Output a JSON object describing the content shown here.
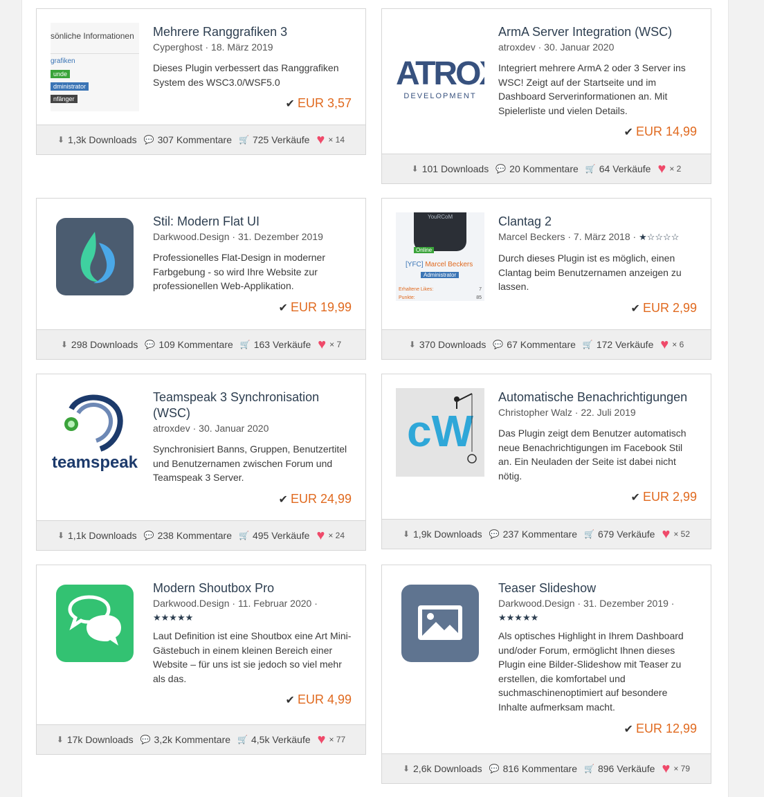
{
  "currency_check": "✔",
  "icons": {
    "download": "download-icon",
    "comments": "comments-icon",
    "cart": "cart-icon",
    "heart": "heart-icon"
  },
  "accent_color": "#e0691e",
  "like_color": "#ef4a6a",
  "cards": [
    {
      "title": "Mehrere Ranggrafiken 3",
      "author": "Cyperghost",
      "date": "18. März 2019",
      "rating": "",
      "desc": "Dieses Plugin verbessert das Ranggrafiken System des WSC3.0/WSF5.0",
      "price": "EUR 3,57",
      "downloads": "1,3k Downloads",
      "comments": "307 Kommentare",
      "sales": "725 Verkäufe",
      "likes": "× 14",
      "thumb_lines": [
        "sönliche Informationen",
        "grafiken",
        "unde",
        "dministrator",
        "nfänger"
      ]
    },
    {
      "title": "ArmA Server Integration (WSC)",
      "author": "atroxdev",
      "date": "30. Januar 2020",
      "rating": "",
      "desc": "Integriert mehrere ArmA 2 oder 3 Server ins WSC! Zeigt auf der Startseite und im Dashboard Serverinformationen an. Mit Spielerliste und vielen Details.",
      "price": "EUR 14,99",
      "downloads": "101 Downloads",
      "comments": "20 Kommentare",
      "sales": "64 Verkäufe",
      "likes": "× 2",
      "logo_text": "ATROX",
      "logo_sub": "DEVELOPMENT"
    },
    {
      "title": "Stil: Modern Flat UI",
      "author": "Darkwood.Design",
      "date": "31. Dezember 2019",
      "rating": "",
      "desc": "Professionelles Flat-Design in moderner Farbgebung - so wird Ihre Website zur professionellen Web-Applikation.",
      "price": "EUR 19,99",
      "downloads": "298 Downloads",
      "comments": "109 Kommentare",
      "sales": "163 Verkäufe",
      "likes": "× 7"
    },
    {
      "title": "Clantag 2",
      "author": "Marcel Beckers",
      "date": "7. März 2018",
      "rating": "★☆☆☆☆",
      "desc": "Durch dieses Plugin ist es möglich, einen Clantag beim Benutzernamen anzeigen zu lassen.",
      "price": "EUR 2,99",
      "downloads": "370 Downloads",
      "comments": "67 Kommentare",
      "sales": "172 Verkäufe",
      "likes": "× 6",
      "thumb_lines": [
        "YouRCoM",
        "Online",
        "[YFC]",
        "Marcel Beckers",
        "Administrator",
        "Erhaltene Likes:",
        "7",
        "Punkte:",
        "85"
      ]
    },
    {
      "title": "Teamspeak 3 Synchronisation (WSC)",
      "author": "atroxdev",
      "date": "30. Januar 2020",
      "rating": "",
      "desc": "Synchronisiert Banns, Gruppen, Benutzertitel und Benutzernamen zwischen Forum und Teamspeak 3 Server.",
      "price": "EUR 24,99",
      "downloads": "1,1k Downloads",
      "comments": "238 Kommentare",
      "sales": "495 Verkäufe",
      "likes": "× 24",
      "logo_text": "teamspeak"
    },
    {
      "title": "Automatische Benachrichtigungen",
      "author": "Christopher Walz",
      "date": "22. Juli 2019",
      "rating": "",
      "desc": "Das Plugin zeigt dem Benutzer automatisch neue Benachrichtigungen im Facebook Stil an. Ein Neuladen der Seite ist dabei nicht nötig.",
      "price": "EUR 2,99",
      "downloads": "1,9k Downloads",
      "comments": "237 Kommentare",
      "sales": "679 Verkäufe",
      "likes": "× 52",
      "logo_text": "cW"
    },
    {
      "title": "Modern Shoutbox Pro",
      "author": "Darkwood.Design",
      "date": "11. Februar 2020",
      "rating": "★★★★★",
      "desc": "Laut Definition ist eine Shoutbox eine Art Mini-Gästebuch in einem kleinen Bereich einer Website – für uns ist sie jedoch so viel mehr als das.",
      "price": "EUR 4,99",
      "downloads": "17k Downloads",
      "comments": "3,2k Kommentare",
      "sales": "4,5k Verkäufe",
      "likes": "× 77"
    },
    {
      "title": "Teaser Slideshow",
      "author": "Darkwood.Design",
      "date": "31. Dezember 2019",
      "rating": "★★★★★",
      "desc": "Als optisches Highlight in Ihrem Dashboard und/oder Forum, ermöglicht Ihnen dieses Plugin eine Bilder-Slideshow mit Teaser zu erstellen, die komfortabel und suchmaschinenoptimiert auf besondere Inhalte aufmerksam macht.",
      "price": "EUR 12,99",
      "downloads": "2,6k Downloads",
      "comments": "816 Kommentare",
      "sales": "896 Verkäufe",
      "likes": "× 79"
    }
  ]
}
